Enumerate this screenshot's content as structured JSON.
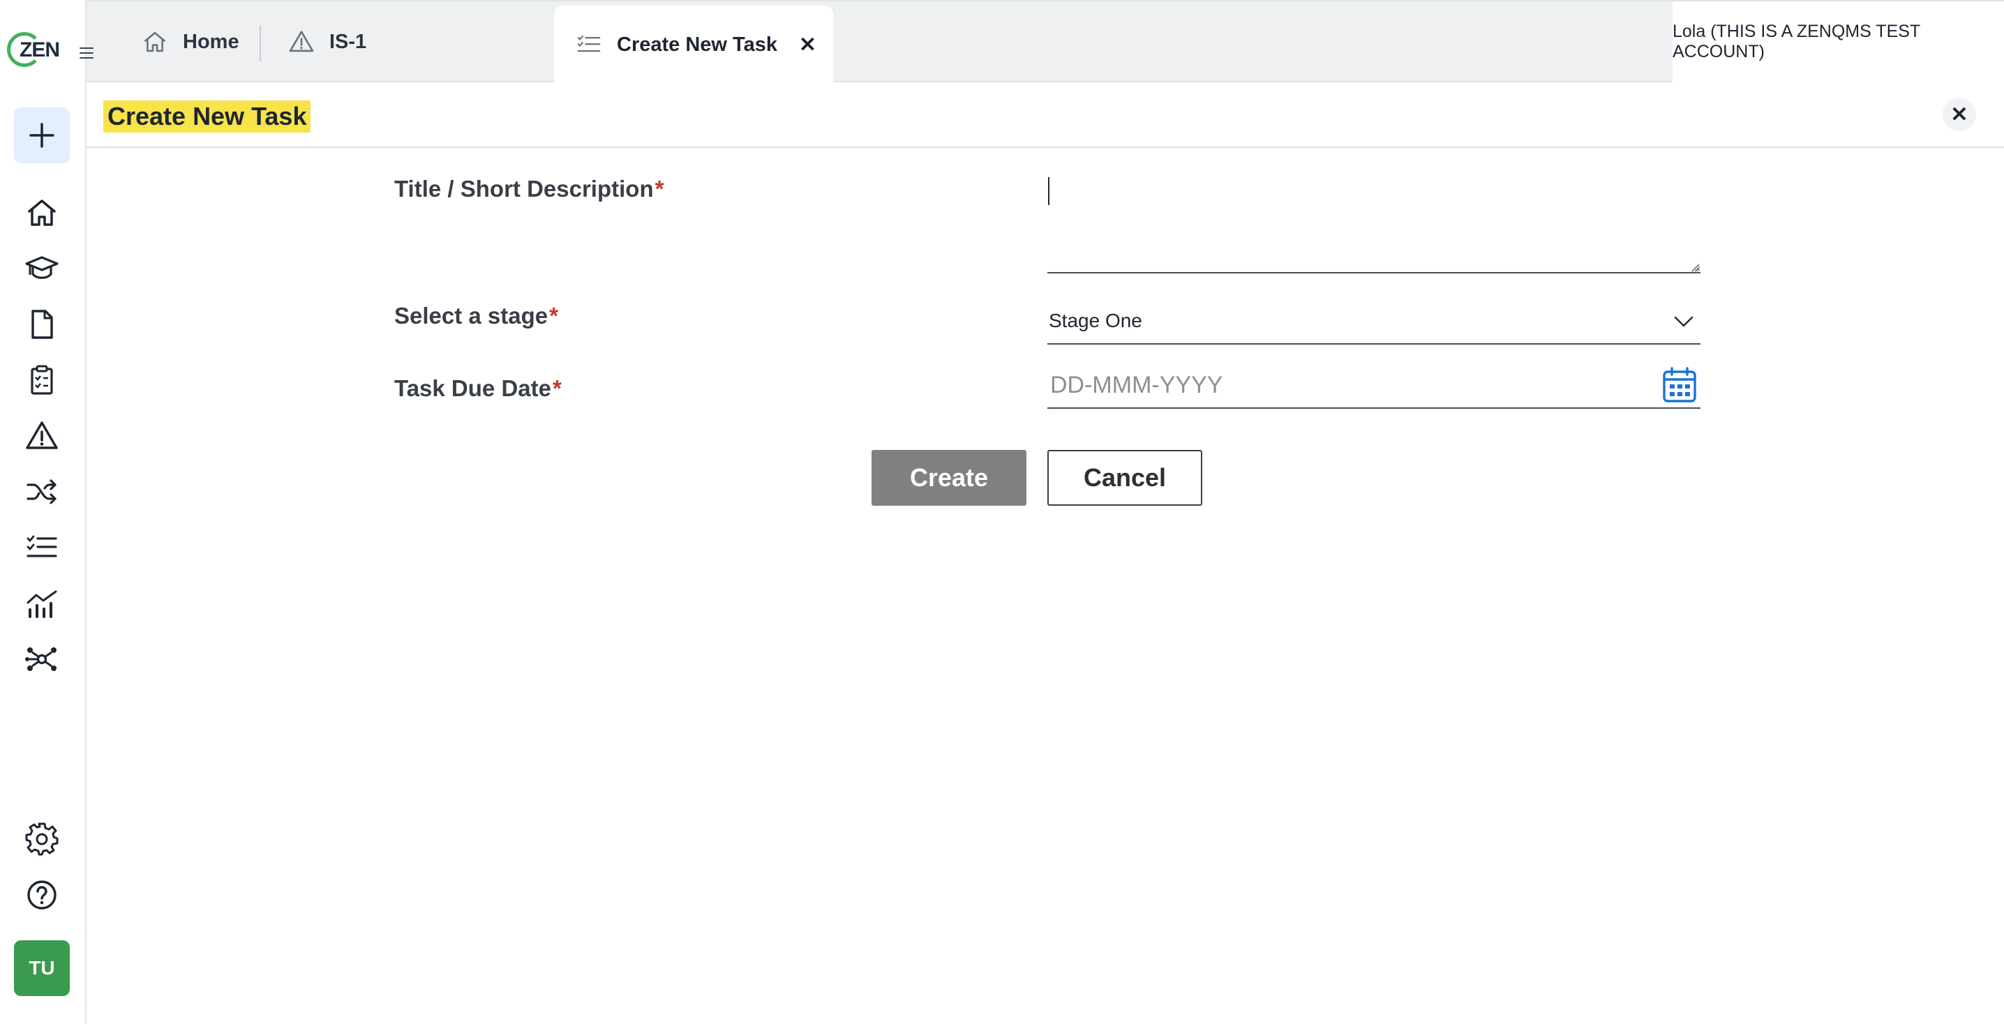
{
  "brand": {
    "logo_text": "ZEN",
    "accent": "#43b05c"
  },
  "sidebar": {
    "new_icon": "plus-icon",
    "items": [
      {
        "name": "home",
        "icon": "home-icon"
      },
      {
        "name": "training",
        "icon": "graduation-cap-icon"
      },
      {
        "name": "documents",
        "icon": "document-icon"
      },
      {
        "name": "audits",
        "icon": "clipboard-checklist-icon"
      },
      {
        "name": "issues",
        "icon": "warning-icon"
      },
      {
        "name": "change",
        "icon": "shuffle-icon"
      },
      {
        "name": "tasks",
        "icon": "task-list-icon"
      },
      {
        "name": "analytics",
        "icon": "analytics-icon"
      },
      {
        "name": "network",
        "icon": "network-icon"
      }
    ],
    "bottom_items": [
      {
        "name": "settings",
        "icon": "gear-icon"
      },
      {
        "name": "help",
        "icon": "help-icon"
      }
    ],
    "avatar_initials": "TU",
    "avatar_color": "#3a9a4d"
  },
  "tabs": [
    {
      "label": "Home",
      "icon": "home-icon"
    },
    {
      "label": "IS-1",
      "icon": "warning-icon"
    },
    {
      "label": "Create New Task",
      "icon": "task-list-icon",
      "active": true,
      "close": "✕"
    }
  ],
  "user": {
    "label": "Lola (THIS IS A ZENQMS TEST ACCOUNT)"
  },
  "page": {
    "title": "Create New Task",
    "title_highlight": "#f7e34a",
    "close": "✕"
  },
  "form": {
    "title_label": "Title / Short Description",
    "title_value": "",
    "stage_label": "Select a stage",
    "stage_value": "Stage One",
    "due_label": "Task Due Date",
    "due_placeholder": "DD-MMM-YYYY",
    "required_mark": "*",
    "create_label": "Create",
    "cancel_label": "Cancel"
  }
}
